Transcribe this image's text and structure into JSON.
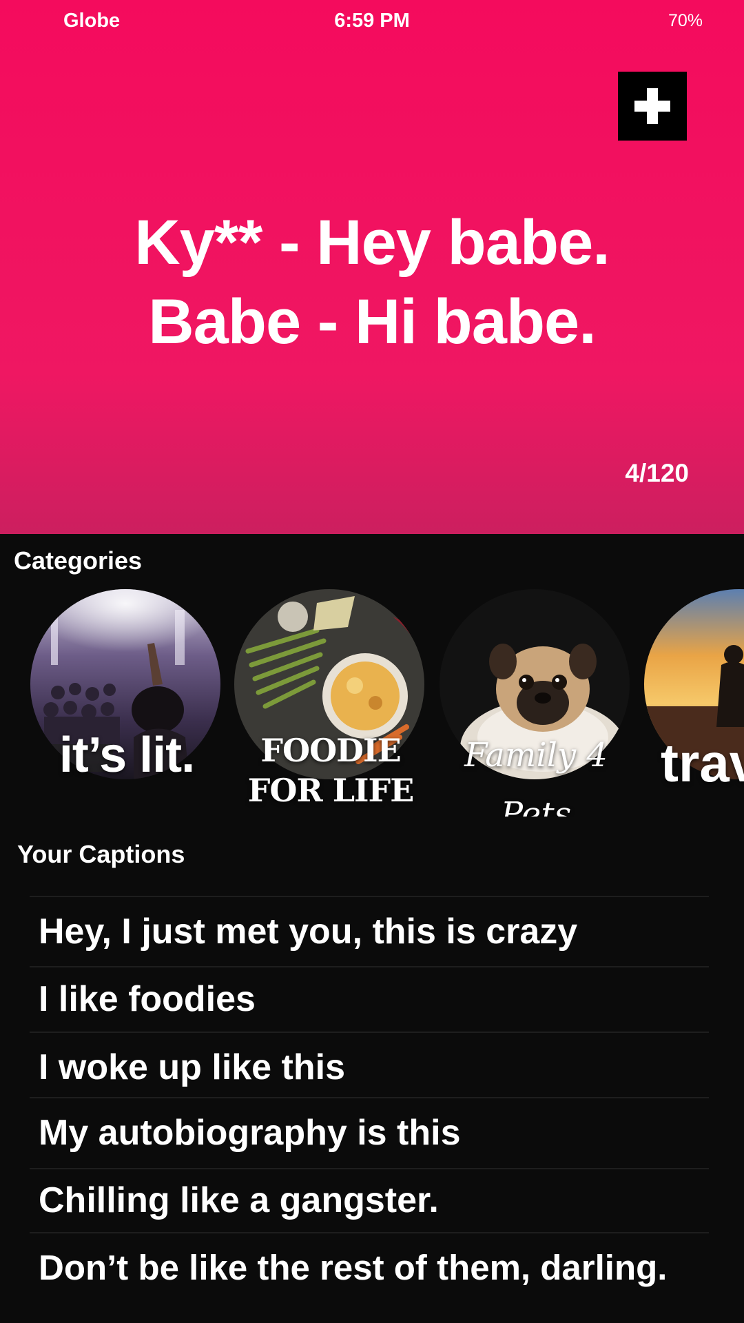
{
  "status_bar": {
    "carrier": "Globe",
    "time": "6:59 PM",
    "battery": "70%"
  },
  "hero": {
    "add_button_icon": "plus-icon",
    "caption_lines": [
      "Ky** - Hey babe.",
      "Babe - Hi babe."
    ],
    "counter": "4/120",
    "background_color": "#f40b5d"
  },
  "categories": {
    "title": "Categories",
    "items": [
      {
        "label": "it’s lit."
      },
      {
        "label_line1": "FOODIE",
        "label_line2": "FOR LIFE"
      },
      {
        "label_line1": "Family 4",
        "label_line2": "Pets"
      },
      {
        "label": "trav"
      }
    ]
  },
  "captions": {
    "title": "Your Captions",
    "items": [
      "Hey, I just met you, this is crazy",
      "I like foodies",
      "I woke up like this",
      "My autobiography is this",
      "Chilling like a gangster.",
      "Don’t be like the rest of them, darling."
    ]
  }
}
